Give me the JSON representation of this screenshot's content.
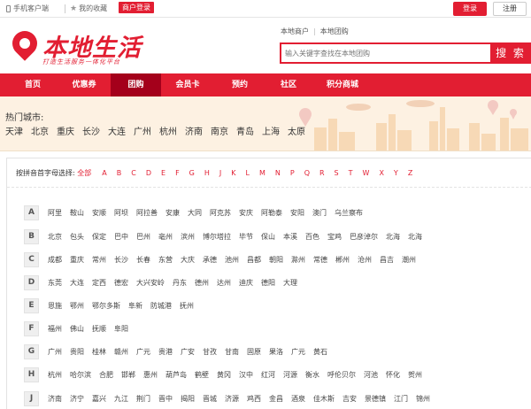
{
  "topbar": {
    "mobile": "手机客户端",
    "favorite": "我的收藏",
    "merchant_login": "商户登录",
    "login": "登录",
    "register": "注册"
  },
  "header": {
    "logo_text": "本地生活",
    "slogan": "打造生活服务一体化平台",
    "link_merchant": "本地商户",
    "link_group": "本地团购",
    "search_placeholder": "输入关键字查找在本地团购",
    "search_button": "搜 索"
  },
  "nav": {
    "items": [
      {
        "label": "首页"
      },
      {
        "label": "优惠券"
      },
      {
        "label": "团购"
      },
      {
        "label": "会员卡"
      },
      {
        "label": "预约"
      },
      {
        "label": "社区"
      },
      {
        "label": "积分商城"
      }
    ],
    "active_index": 2
  },
  "hot": {
    "title": "热门城市:",
    "cities": [
      "天津",
      "北京",
      "重庆",
      "长沙",
      "大连",
      "广州",
      "杭州",
      "济南",
      "南京",
      "青岛",
      "上海",
      "太原"
    ]
  },
  "pinyin": {
    "label": "按拼音首字母选择:",
    "all": "全部",
    "letters": [
      "A",
      "B",
      "C",
      "D",
      "E",
      "F",
      "G",
      "H",
      "J",
      "K",
      "L",
      "M",
      "N",
      "P",
      "Q",
      "R",
      "S",
      "T",
      "W",
      "X",
      "Y",
      "Z"
    ]
  },
  "city_groups": [
    {
      "letter": "A",
      "cities": [
        "阿里",
        "鞍山",
        "安顺",
        "阿坝",
        "阿拉善",
        "安康",
        "大同",
        "阿克苏",
        "安庆",
        "阿勒泰",
        "安阳",
        "澳门",
        "乌兰察布"
      ]
    },
    {
      "letter": "B",
      "cities": [
        "北京",
        "包头",
        "保定",
        "巴中",
        "巴州",
        "亳州",
        "滨州",
        "博尔塔拉",
        "毕节",
        "保山",
        "本溪",
        "百色",
        "宝鸡",
        "巴彦淖尔",
        "北海",
        "北海"
      ]
    },
    {
      "letter": "C",
      "cities": [
        "成都",
        "重庆",
        "常州",
        "长沙",
        "长春",
        "东营",
        "大庆",
        "承德",
        "池州",
        "昌都",
        "朝阳",
        "滁州",
        "常德",
        "郴州",
        "沧州",
        "昌吉",
        "潮州"
      ]
    },
    {
      "letter": "D",
      "cities": [
        "东莞",
        "大连",
        "定西",
        "德宏",
        "大兴安岭",
        "丹东",
        "德州",
        "达州",
        "迪庆",
        "德阳",
        "大理"
      ]
    },
    {
      "letter": "E",
      "cities": [
        "恩施",
        "鄂州",
        "鄂尔多斯",
        "阜新",
        "防城港",
        "抚州"
      ]
    },
    {
      "letter": "F",
      "cities": [
        "福州",
        "佛山",
        "抚顺",
        "阜阳"
      ]
    },
    {
      "letter": "G",
      "cities": [
        "广州",
        "贵阳",
        "桂林",
        "赣州",
        "广元",
        "贵港",
        "广安",
        "甘孜",
        "甘南",
        "固原",
        "果洛",
        "广元",
        "黄石"
      ]
    },
    {
      "letter": "H",
      "cities": [
        "杭州",
        "哈尔滨",
        "合肥",
        "邯郸",
        "惠州",
        "葫芦岛",
        "鹤壁",
        "黄冈",
        "汉中",
        "红河",
        "河源",
        "衡水",
        "呼伦贝尔",
        "河池",
        "怀化",
        "贺州"
      ]
    },
    {
      "letter": "J",
      "cities": [
        "济南",
        "济宁",
        "嘉兴",
        "九江",
        "荆门",
        "晋中",
        "揭阳",
        "晋城",
        "济源",
        "鸡西",
        "金昌",
        "酒泉",
        "佳木斯",
        "吉安",
        "景德镇",
        "江门",
        "锦州"
      ]
    }
  ]
}
